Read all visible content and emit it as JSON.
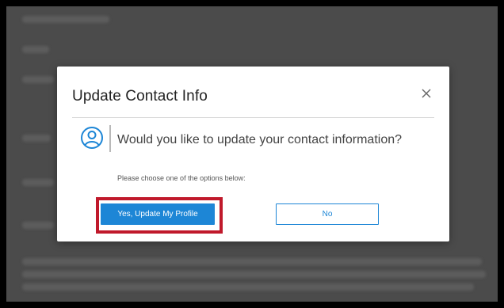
{
  "dialog": {
    "title": "Update Contact Info",
    "close_icon": "close-icon",
    "user_icon": "user-circle-icon",
    "question": "Would you like to update your contact information?",
    "hint": "Please choose one of the options below:",
    "yes_label": "Yes, Update My Profile",
    "no_label": "No"
  },
  "colors": {
    "primary": "#1d86d6",
    "highlight": "#c0192b",
    "overlay": "#4b4b4b"
  }
}
